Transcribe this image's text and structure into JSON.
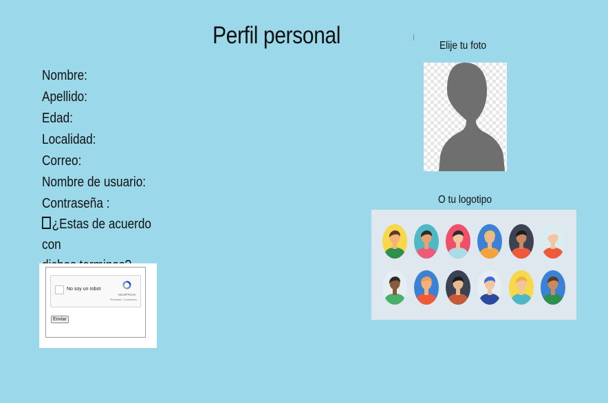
{
  "page": {
    "title": "Perfil personal"
  },
  "form": {
    "fields": [
      {
        "id": "nombre",
        "label": "Nombre:"
      },
      {
        "id": "apellido",
        "label": "Apellido:"
      },
      {
        "id": "edad",
        "label": "Edad:"
      },
      {
        "id": "localidad",
        "label": "Localidad:"
      },
      {
        "id": "correo",
        "label": "Correo:"
      },
      {
        "id": "usuario",
        "label": "Nombre de usuario:"
      },
      {
        "id": "contrasena",
        "label": "Contraseña :"
      }
    ],
    "agree_line1": "¿Estas de acuerdo con",
    "agree_line2": "dichos terminos?"
  },
  "captcha": {
    "checkbox_label": "No soy un robot",
    "brand": "reCAPTCHA",
    "terms": "Privacidad - Condiciones",
    "submit_label": "Enviar"
  },
  "photo": {
    "label": "Elije tu foto"
  },
  "logos": {
    "label": "O tu logotipo",
    "avatars": [
      {
        "bg": "#f6d84a",
        "skin": "#f2b27a",
        "hair": "#5a3a22",
        "shirt": "#2f8f4e"
      },
      {
        "bg": "#4fb8c4",
        "skin": "#e8a070",
        "hair": "#2c2c2c",
        "shirt": "#ef5a7a"
      },
      {
        "bg": "#ef4f6b",
        "skin": "#f2c4a0",
        "hair": "#2c2c2c",
        "shirt": "#a8dde6"
      },
      {
        "bg": "#3b82d6",
        "skin": "#f0b888",
        "hair": "#e8c06a",
        "shirt": "#f4a23a"
      },
      {
        "bg": "#3d4252",
        "skin": "#c98a62",
        "hair": "#1c1c1c",
        "shirt": "#ef5a3a"
      },
      {
        "bg": "#d9ecef",
        "skin": "#f2c4a0",
        "hair": "#e8e8e8",
        "shirt": "#ef5a3a"
      },
      {
        "bg": "#e6eef2",
        "skin": "#8a5a3a",
        "hair": "#2c2c2c",
        "shirt": "#49b06a"
      },
      {
        "bg": "#3b82d6",
        "skin": "#f2b27a",
        "hair": "#f0a050",
        "shirt": "#ef5a3a"
      },
      {
        "bg": "#3d4252",
        "skin": "#e8b890",
        "hair": "#1c1c1c",
        "shirt": "#c65a3a"
      },
      {
        "bg": "#e6eef2",
        "skin": "#f2c4a0",
        "hair": "#3b6ad6",
        "shirt": "#2b4aa0"
      },
      {
        "bg": "#f6d84a",
        "skin": "#f2c4a0",
        "hair": "#f0b040",
        "shirt": "#4fb8c4"
      },
      {
        "bg": "#3b82d6",
        "skin": "#c98a62",
        "hair": "#5a3a22",
        "shirt": "#2f8f4e"
      }
    ]
  }
}
